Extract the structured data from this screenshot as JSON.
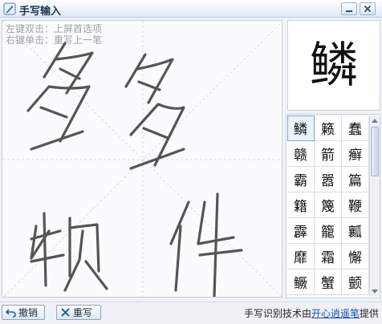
{
  "window": {
    "title": "手写输入"
  },
  "canvas": {
    "hint_line1": "左键双击：上屏首选项",
    "hint_line2": "右键单击：重写上一笔"
  },
  "preview": {
    "char": "鳞"
  },
  "candidates": [
    "鳞",
    "籁",
    "蠢",
    "赣",
    "箭",
    "癣",
    "霸",
    "嚣",
    "篇",
    "籍",
    "篾",
    "鞭",
    "霹",
    "籠",
    "瓤",
    "靡",
    "霜",
    "懈",
    "鳜",
    "蟹",
    "颤"
  ],
  "buttons": {
    "undo_label": "撤销",
    "rewrite_label": "重写"
  },
  "footer": {
    "credit_prefix": "手写识别技术由",
    "credit_link": "开心逍遥笔",
    "credit_suffix": "提供"
  },
  "colors": {
    "ink": "#555555",
    "accent": "#1a4fb5"
  }
}
